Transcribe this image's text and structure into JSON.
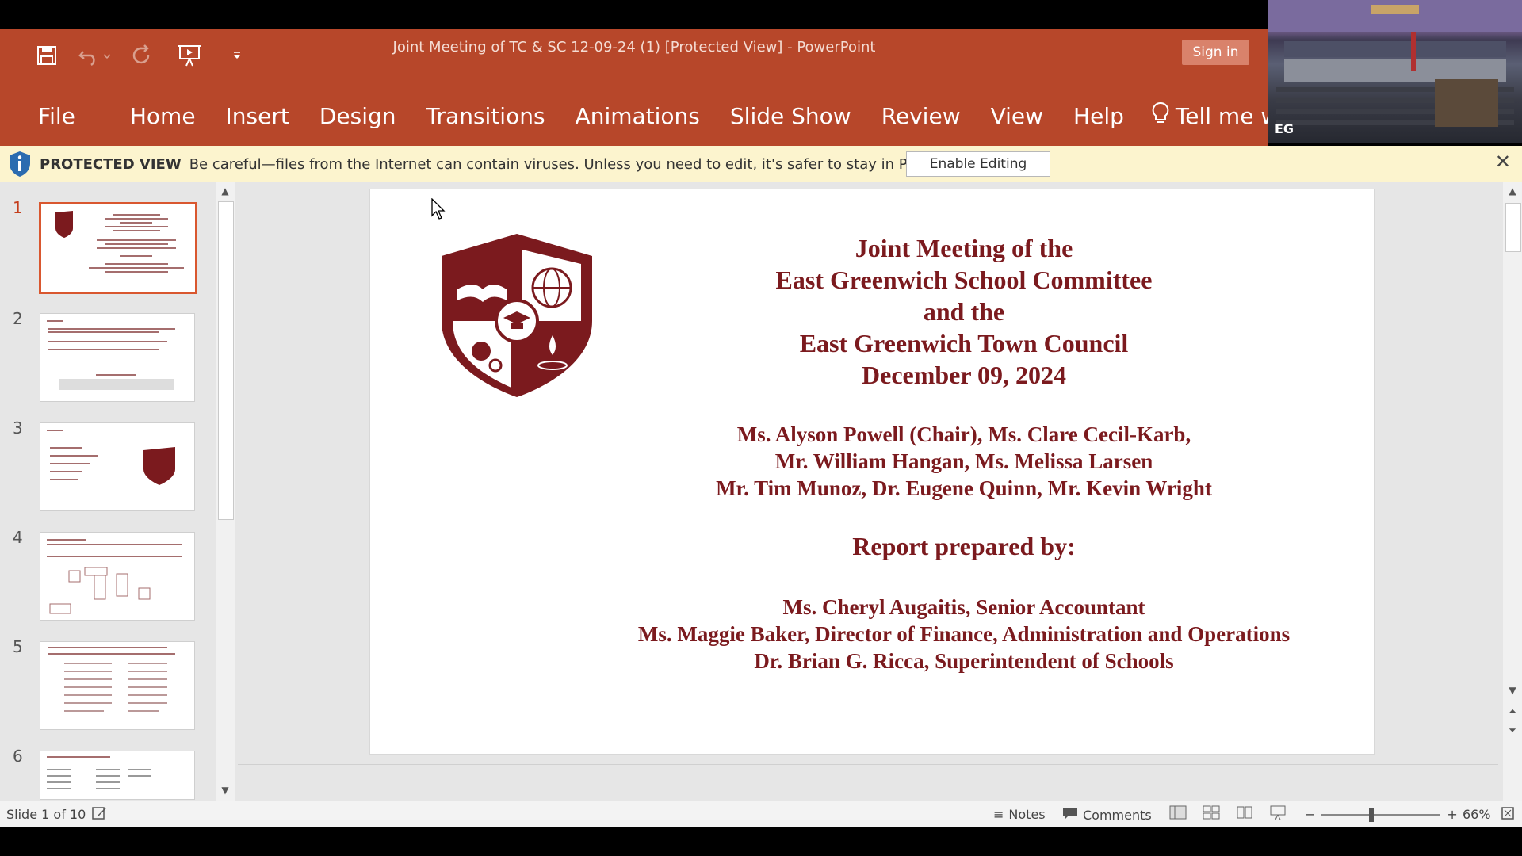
{
  "window": {
    "title": "Joint Meeting of TC & SC  12-09-24 (1) [Protected View]  -  PowerPoint",
    "sign_in": "Sign in"
  },
  "quick_access": {
    "icons": [
      "save-icon",
      "undo-icon",
      "redo-icon",
      "start-from-beginning-icon",
      "customize-qat-icon"
    ]
  },
  "ribbon_tabs": [
    "File",
    "Home",
    "Insert",
    "Design",
    "Transitions",
    "Animations",
    "Slide Show",
    "Review",
    "View",
    "Help"
  ],
  "tell_me": "Tell me what you",
  "video_overlay": {
    "label": "EG"
  },
  "protected_view": {
    "label": "PROTECTED VIEW",
    "message": "Be careful—files from the Internet can contain viruses. Unless you need to edit, it's safer to stay in Protected View.",
    "button": "Enable Editing"
  },
  "thumbnails": [
    {
      "number": "1",
      "selected": true
    },
    {
      "number": "2",
      "selected": false
    },
    {
      "number": "3",
      "selected": false
    },
    {
      "number": "4",
      "selected": false
    },
    {
      "number": "5",
      "selected": false
    },
    {
      "number": "6",
      "selected": false
    }
  ],
  "slide": {
    "title_lines": [
      "Joint Meeting of the",
      "East Greenwich School Committee",
      "and the",
      "East Greenwich Town Council",
      "December 09, 2024"
    ],
    "members_lines": [
      "Ms. Alyson Powell (Chair),  Ms. Clare Cecil-Karb,",
      "Mr. William Hangan, Ms. Melissa Larsen",
      "Mr. Tim Munoz, Dr. Eugene Quinn, Mr. Kevin Wright"
    ],
    "report_heading": "Report prepared by:",
    "preparers_lines": [
      "Ms. Cheryl Augaitis, Senior Accountant",
      "Ms. Maggie Baker, Director of Finance, Administration and Operations",
      "Dr. Brian G. Ricca, Superintendent of Schools"
    ],
    "accent_color": "#7B1A1E"
  },
  "status_bar": {
    "slide_indicator": "Slide 1 of 10",
    "notes": "Notes",
    "comments": "Comments",
    "zoom": "66%"
  },
  "colors": {
    "ribbon": "#B7472A",
    "protected_bar": "#FCF4CE",
    "selection": "#D9572F"
  }
}
